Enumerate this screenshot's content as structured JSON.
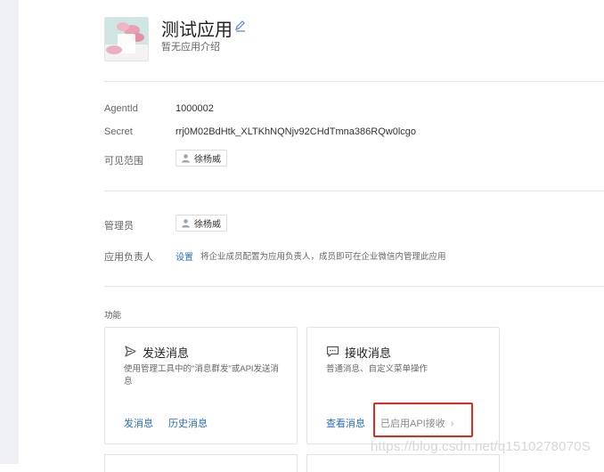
{
  "app": {
    "title": "测试应用",
    "description": "暂无应用介绍"
  },
  "info": {
    "agentid_label": "AgentId",
    "agentid_value": "1000002",
    "secret_label": "Secret",
    "secret_value": "rrj0M02BdHtk_XLTKhNQNjv92CHdTmna386RQw0lcgo",
    "visible_label": "可见范围",
    "visible_user": "徐杨威"
  },
  "admin": {
    "admin_label": "管理员",
    "admin_user": "徐杨威",
    "owner_label": "应用负责人",
    "owner_link": "设置",
    "owner_desc": "将企业成员配置为应用负责人，成员即可在企业微信内管理此应用"
  },
  "features": {
    "section_label": "功能",
    "send_card": {
      "title": "发送消息",
      "desc": "使用管理工具中的\"消息群发\"或API发送消息",
      "link1": "发消息",
      "link2": "历史消息"
    },
    "receive_card": {
      "title": "接收消息",
      "desc": "普通消息、自定义菜单操作",
      "link1": "查看消息",
      "link2": "已启用API接收",
      "link2_arrow": "›"
    }
  },
  "watermark": "https://blog.csdn.net/q1510278070S",
  "colors": {
    "link": "#2b6dbd",
    "highlight": "#e42a1f",
    "divider": "#e6e6e6"
  }
}
